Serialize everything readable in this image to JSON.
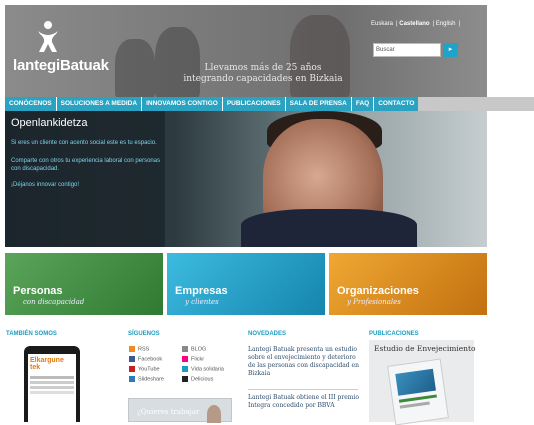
{
  "header": {
    "logo_text": "lantegiBatuak",
    "tagline": "Llevamos más de 25 años integrando capacidades en Bizkaia",
    "languages": [
      "Euskara",
      "Castellano",
      "English"
    ],
    "selected_language": "Castellano",
    "search_value": "Buscar"
  },
  "nav": {
    "items": [
      "CONÓCENOS",
      "SOLUCIONES A MEDIDA",
      "INNOVAMOS CONTIGO",
      "PUBLICACIONES",
      "SALA DE PRENSA",
      "FAQ",
      "CONTACTO"
    ]
  },
  "hero": {
    "title": "Openlankidetza",
    "p1": "Si eres un cliente con acento social este es tu espacio.",
    "p2": "Comparte con otros tu experiencia laboral con personas con discapacidad.",
    "p3": "¡Déjanos innovar contigo!"
  },
  "tiles": [
    {
      "t1": "Personas",
      "t2": "con discapacidad",
      "color": "#3c8a3a"
    },
    {
      "t1": "Empresas",
      "t2": "y clientes",
      "color": "#1c9fc5"
    },
    {
      "t1": "Organizaciones",
      "t2": "y Profesionales",
      "color": "#e08e1a"
    }
  ],
  "columns": {
    "tambien_somos": "TAMBIÉN SOMOS",
    "siguenos": "SÍGUENOS",
    "novedades": "NOVEDADES",
    "publicaciones": "PUBLICACIONES"
  },
  "social": [
    "RSS",
    "Facebook",
    "YouTube",
    "Slideshare",
    "BLOG",
    "Flickr",
    "Vida solidaria",
    "Delicious"
  ],
  "social_promo": "¿Quieres trabajar",
  "brand_box": "Elkargune tek",
  "news": [
    "Lantegi Batuak presenta un estudio sobre el envejecimiento y deterioro de las personas con discapacidad en Bizkaia",
    "Lantegi Batuak obtiene el III premio Integra concedido por BBVA"
  ],
  "publication_title": "Estudio de Envejecimiento"
}
